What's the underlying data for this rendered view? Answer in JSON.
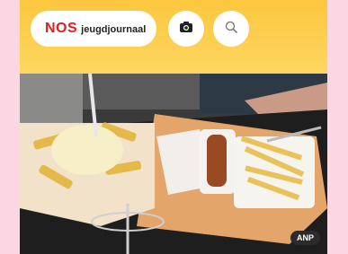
{
  "header": {
    "logo": {
      "brand": "NOS",
      "sub": "jeugdjournaal"
    },
    "buttons": [
      {
        "icon": "camera-icon"
      },
      {
        "icon": "search-icon"
      }
    ]
  },
  "photo": {
    "credit": "ANP"
  },
  "colors": {
    "page_bg": "#fbd6e3",
    "header_yellow": "#fcc73e",
    "brand_red": "#e11f22"
  }
}
